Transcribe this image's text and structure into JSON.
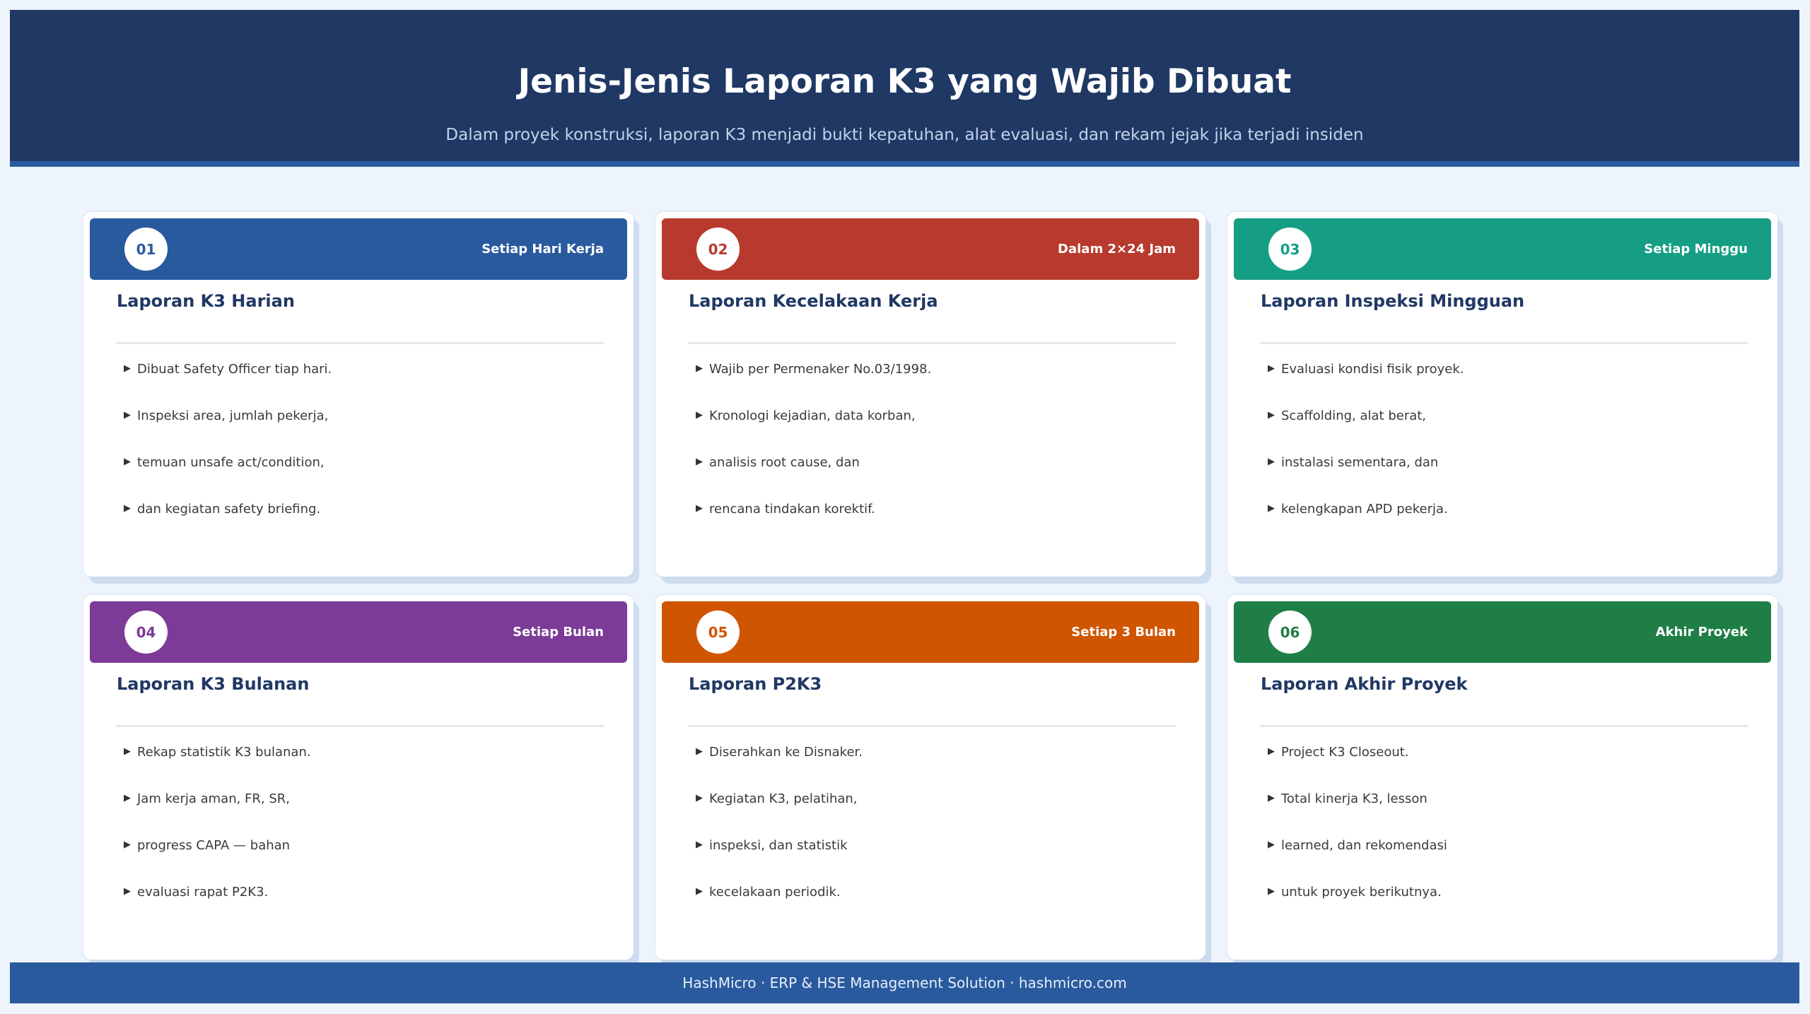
{
  "header": {
    "title": "Jenis-Jenis Laporan K3 yang Wajib Dibuat",
    "subtitle": "Dalam proyek konstruksi, laporan K3 menjadi bukti kepatuhan, alat evaluasi, dan rekam jejak jika terjadi insiden"
  },
  "cards": [
    {
      "number": "01",
      "frequency": "Setiap Hari Kerja",
      "title": "Laporan K3 Harian",
      "color": "#2a5a9e",
      "items": [
        "Dibuat Safety Officer tiap hari.",
        "Inspeksi area, jumlah pekerja,",
        "temuan unsafe act/condition,",
        "dan kegiatan safety briefing."
      ]
    },
    {
      "number": "02",
      "frequency": "Dalam 2×24 Jam",
      "title": "Laporan Kecelakaan Kerja",
      "color": "#b83a2e",
      "items": [
        "Wajib per Permenaker No.03/1998.",
        "Kronologi kejadian, data korban,",
        "analisis root cause, dan",
        "rencana tindakan korektif."
      ]
    },
    {
      "number": "03",
      "frequency": "Setiap Minggu",
      "title": "Laporan Inspeksi Mingguan",
      "color": "#169e84",
      "items": [
        "Evaluasi kondisi fisik proyek.",
        "Scaffolding, alat berat,",
        "instalasi sementara, dan",
        "kelengkapan APD pekerja."
      ]
    },
    {
      "number": "04",
      "frequency": "Setiap Bulan",
      "title": "Laporan K3 Bulanan",
      "color": "#7b3b96",
      "items": [
        "Rekap statistik K3 bulanan.",
        "Jam kerja aman, FR, SR,",
        "progress CAPA — bahan",
        "evaluasi rapat P2K3."
      ]
    },
    {
      "number": "05",
      "frequency": "Setiap 3 Bulan",
      "title": "Laporan P2K3",
      "color": "#d05500",
      "items": [
        "Diserahkan ke Disnaker.",
        "Kegiatan K3, pelatihan,",
        "inspeksi, dan statistik",
        "kecelakaan periodik."
      ]
    },
    {
      "number": "06",
      "frequency": "Akhir Proyek",
      "title": "Laporan Akhir Proyek",
      "color": "#1e7e46",
      "items": [
        "Project K3 Closeout.",
        "Total kinerja K3, lesson",
        "learned, dan rekomendasi",
        "untuk proyek berikutnya."
      ]
    }
  ],
  "footer": {
    "text": "HashMicro  ·  ERP & HSE Management Solution  ·  hashmicro.com"
  }
}
